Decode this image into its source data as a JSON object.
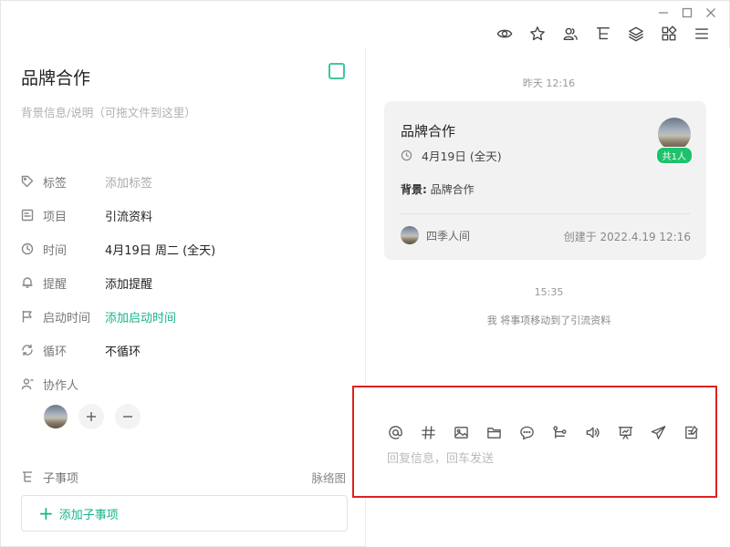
{
  "window": {
    "controls": [
      "minimize",
      "maximize",
      "close"
    ]
  },
  "toolbar": {
    "icons": [
      "eye-icon",
      "star-icon",
      "users-icon",
      "tree-icon",
      "layers-icon",
      "apps-icon",
      "menu-icon"
    ]
  },
  "task": {
    "title": "品牌合作",
    "description_placeholder": "背景信息/说明（可拖文件到这里）",
    "fields": {
      "tag": {
        "label": "标签",
        "value": "添加标签"
      },
      "project": {
        "label": "项目",
        "value": "引流资料"
      },
      "time": {
        "label": "时间",
        "value": "4月19日 周二 (全天)"
      },
      "reminder": {
        "label": "提醒",
        "value": "添加提醒"
      },
      "start_time": {
        "label": "启动时间",
        "value": "添加启动时间"
      },
      "repeat": {
        "label": "循环",
        "value": "不循环"
      },
      "collaborators": {
        "label": "协作人"
      }
    },
    "subtasks": {
      "label": "子事项",
      "mindmap": "脉络图",
      "add_label": "添加子事项"
    }
  },
  "feed": {
    "time1": "昨天 12:16",
    "card": {
      "title": "品牌合作",
      "date": "4月19日 (全天)",
      "badge": "共1人",
      "background_label": "背景:",
      "background_value": "品牌合作",
      "owner": "四季人间",
      "created": "创建于 2022.4.19 12:16"
    },
    "time2": "15:35",
    "activity": "我 将事项移动到了引流资料"
  },
  "reply": {
    "placeholder": "回复信息，回车发送"
  },
  "colors": {
    "accent": "#19b38b",
    "badge": "#1ec26b",
    "highlight_border": "#e02020"
  }
}
